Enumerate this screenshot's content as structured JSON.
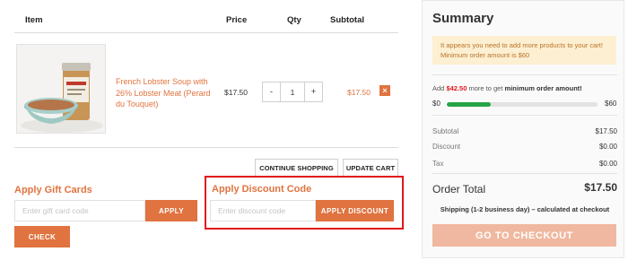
{
  "cart": {
    "headers": {
      "item": "Item",
      "price": "Price",
      "qty": "Qty",
      "subtotal": "Subtotal"
    },
    "items": [
      {
        "name": "French Lobster Soup with 26% Lobster Meat (Perard du Touquet)",
        "price": "$17.50",
        "quantity": "1",
        "qty_minus": "-",
        "qty_plus": "+",
        "subtotal": "$17.50",
        "remove_icon": "×",
        "image_icon": "product-photo-icon"
      }
    ],
    "continue_label": "CONTINUE SHOPPING",
    "update_label": "UPDATE CART"
  },
  "gift": {
    "title": "Apply Gift Cards",
    "placeholder": "Enter gift card code",
    "apply_label": "APPLY",
    "check_label": "CHECK"
  },
  "discount": {
    "title": "Apply Discount Code",
    "placeholder": "Enter discount code",
    "apply_label": "APPLY DISCOUNT",
    "highlight_color": "#e2161b"
  },
  "summary": {
    "title": "Summary",
    "notice": "It appears you need to add more products to your cart! Minimum order amount is $60",
    "progress": {
      "prefix": "Add",
      "amount": "$42.50",
      "middle": "more to get",
      "suffix": "minimum order amount!",
      "min_label": "$0",
      "max_label": "$60",
      "fraction": 0.2917
    },
    "rows": [
      {
        "label": "Subtotal",
        "value": "$17.50"
      },
      {
        "label": "Discount",
        "value": "$0.00"
      },
      {
        "label": "Tax",
        "value": "$0.00"
      }
    ],
    "total_label": "Order Total",
    "total_value": "$17.50",
    "shipping_note": "Shipping (1-2 business day) – calculated at checkout",
    "checkout_label": "GO TO CHECKOUT"
  },
  "colors": {
    "accent": "#e0733f",
    "progress": "#25a447",
    "checkout_disabled": "#f0b8a0",
    "notice_bg": "#fdefd1"
  }
}
